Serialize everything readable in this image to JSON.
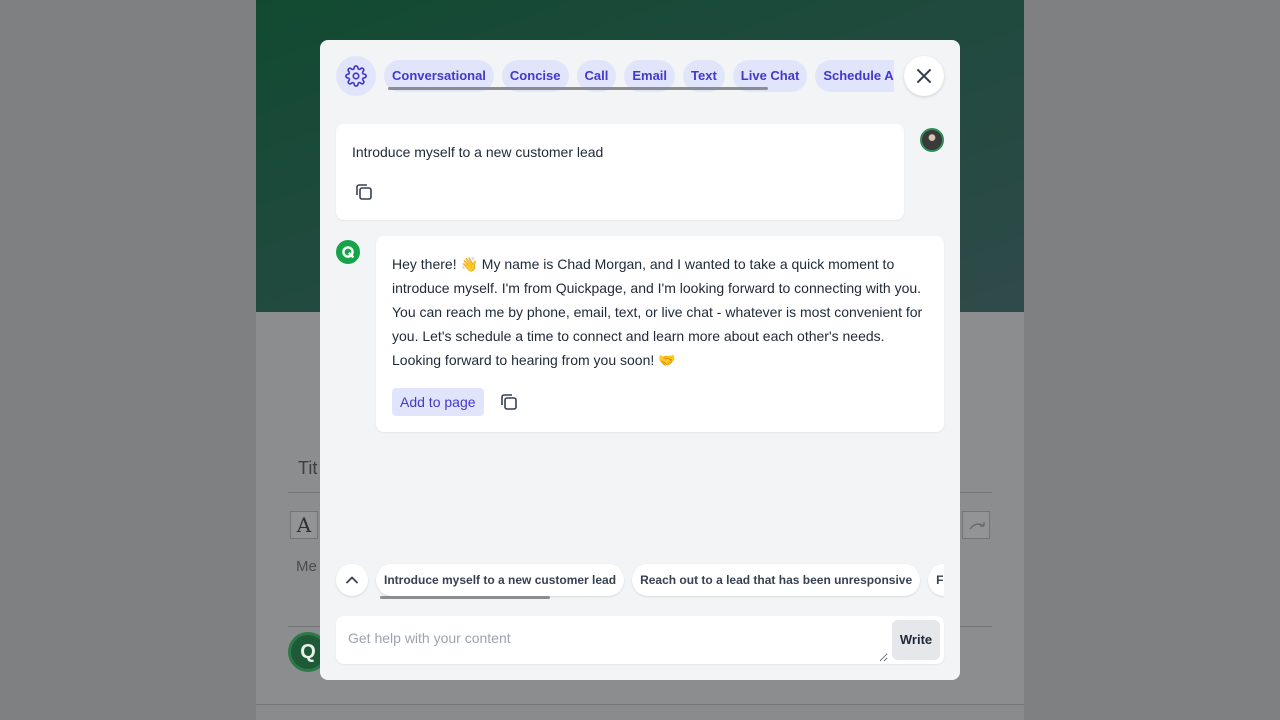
{
  "background": {
    "title_placeholder": "Tit",
    "format_icon_glyph": "A",
    "body_placeholder": "Me"
  },
  "modal": {
    "tabs": [
      {
        "label": "Conversational"
      },
      {
        "label": "Concise"
      },
      {
        "label": "Call"
      },
      {
        "label": "Email"
      },
      {
        "label": "Text"
      },
      {
        "label": "Live Chat"
      },
      {
        "label": "Schedule Appointment"
      }
    ],
    "user_message": "Introduce myself to a new customer lead",
    "bot_message": "Hey there! 👋 My name is Chad Morgan, and I wanted to take a quick moment to introduce myself. I'm from Quickpage, and I'm looking forward to connecting with you. You can reach me by phone, email, text, or live chat - whatever is most convenient for you. Let's schedule a time to connect and learn more about each other's needs. Looking forward to hearing from you soon! 🤝",
    "add_to_page_label": "Add to page",
    "suggestions": [
      {
        "label": "Introduce myself to a new customer lead"
      },
      {
        "label": "Reach out to a lead that has been unresponsive"
      },
      {
        "label": "Follow up"
      }
    ],
    "input": {
      "placeholder": "Get help with your content",
      "value": ""
    },
    "write_label": "Write"
  },
  "colors": {
    "accent": "#4338ca",
    "accent_bg": "#e0e5fb",
    "brand_green": "#16a34a",
    "hero_green": "#114a31"
  },
  "icons": {
    "settings": "gear-icon",
    "close": "close-icon",
    "copy": "copy-icon",
    "suggestions_toggle": "chevron-up-icon",
    "bot": "quickpage-logo-icon"
  }
}
